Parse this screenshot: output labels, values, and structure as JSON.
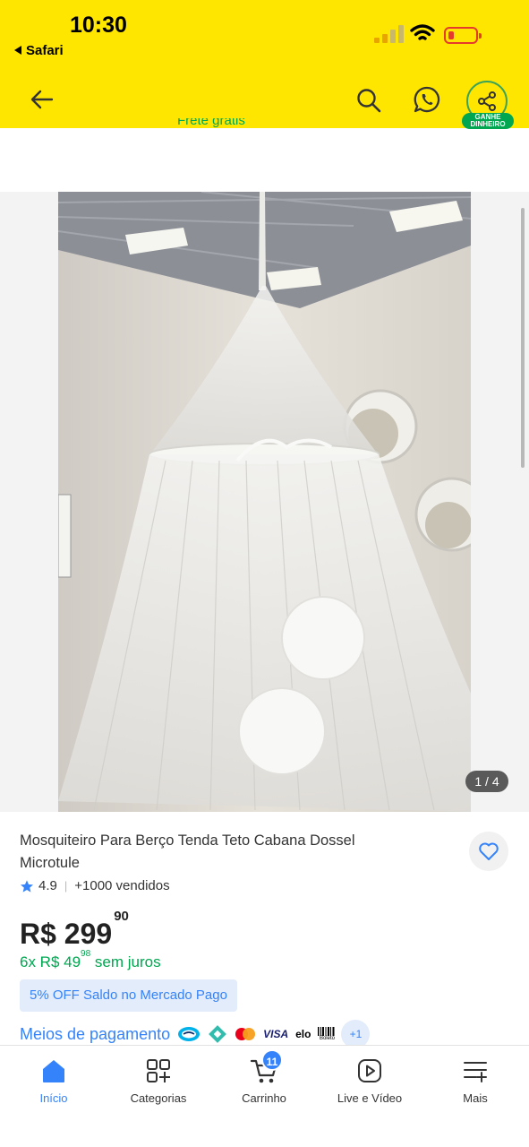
{
  "status_bar": {
    "time": "10:30",
    "back_app": "Safari",
    "signal_bars": 2,
    "battery_level": 0.15
  },
  "header": {
    "share_badge_line1": "GANHE",
    "share_badge_line2": "DINHEIRO",
    "cut_text": "Frete grátis"
  },
  "gallery": {
    "counter": "1 / 4"
  },
  "product": {
    "title": "Mosquiteiro Para Berço Tenda Teto Cabana Dossel Microtule",
    "rating": "4.9",
    "sold": "+1000 vendidos",
    "price_currency": "R$",
    "price_int": "299",
    "price_cents": "90",
    "installments_prefix": "6x R$ 49",
    "installments_cents": "98",
    "installments_suffix": " sem juros",
    "promo": "5% OFF Saldo no Mercado Pago",
    "payments_label": "Meios de pagamento",
    "payments_more": "+1",
    "payment_methods": [
      "mercado-pago",
      "pix",
      "mastercard",
      "VISA",
      "elo",
      "Boleto"
    ]
  },
  "tabbar": {
    "items": [
      {
        "label": "Início",
        "icon": "home-icon",
        "active": true
      },
      {
        "label": "Categorias",
        "icon": "categories-icon"
      },
      {
        "label": "Carrinho",
        "icon": "cart-icon",
        "badge": "11"
      },
      {
        "label": "Live e Vídeo",
        "icon": "play-icon"
      },
      {
        "label": "Mais",
        "icon": "menu-plus-icon"
      }
    ]
  },
  "colors": {
    "brand_yellow": "#FFE600",
    "link_blue": "#3483fa",
    "success_green": "#00a650"
  }
}
